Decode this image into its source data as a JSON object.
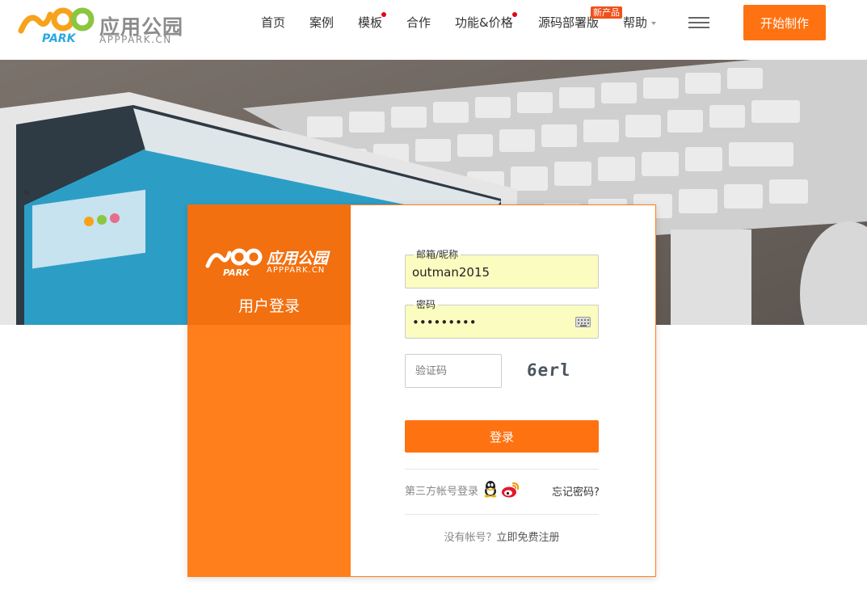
{
  "header": {
    "logo": {
      "cn": "应用公园",
      "en": "APPPARK.CN",
      "mark_text": "PARK"
    },
    "nav": [
      {
        "label": "首页"
      },
      {
        "label": "案例"
      },
      {
        "label": "模板"
      },
      {
        "label": "合作"
      },
      {
        "label": "功能&价格"
      },
      {
        "label": "源码部署版"
      },
      {
        "label": "帮助"
      }
    ],
    "new_badge": "新产品",
    "start_button": "开始制作"
  },
  "login": {
    "logo": {
      "cn": "应用公园",
      "en": "APPPARK.CN",
      "mark_text": "PARK"
    },
    "title": "用户登录",
    "email": {
      "label": "邮箱/昵称",
      "value": "outman2015"
    },
    "password": {
      "label": "密码",
      "value": "•••••••••"
    },
    "captcha": {
      "placeholder": "验证码",
      "code": "6erl"
    },
    "submit": "登录",
    "third_party": "第三方帐号登录",
    "forgot": "忘记密码?",
    "no_account": "没有帐号？",
    "register": "立即免费注册"
  },
  "colors": {
    "brand_orange": "#ff7212",
    "card_orange": "#ff7f1c",
    "badge_red": "#f0501c",
    "autofill_yellow": "#fafcc0"
  },
  "icons": [
    "logo-mark",
    "dot-indicator",
    "chevron-down-icon",
    "menu-icon",
    "keyboard-icon",
    "qq-icon",
    "weibo-icon"
  ]
}
